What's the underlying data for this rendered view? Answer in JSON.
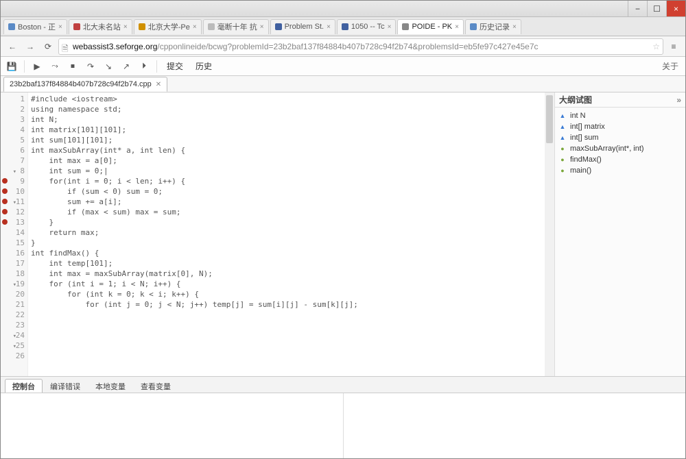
{
  "window_controls": {
    "min": "−",
    "max": "☐",
    "close": "×"
  },
  "browser_tabs": [
    {
      "label": "Boston - 正",
      "favicon": "#5a8ac6",
      "active": false
    },
    {
      "label": "北大未名站",
      "favicon": "#c04040",
      "active": false
    },
    {
      "label": "北京大学-Pe",
      "favicon": "#d09000",
      "active": false
    },
    {
      "label": "毫断十年 抗",
      "favicon": "#bbbbbb",
      "active": false
    },
    {
      "label": "Problem St.",
      "favicon": "#4060a0",
      "active": false
    },
    {
      "label": "1050 -- Tc",
      "favicon": "#4060a0",
      "active": false
    },
    {
      "label": "POIDE - PK",
      "favicon": "#888888",
      "active": true
    },
    {
      "label": "历史记录",
      "favicon": "#5a8ac6",
      "active": false
    }
  ],
  "address_bar": {
    "host": "webassist3.seforge.org",
    "path": "/cpponlineide/bcwg?problemId=23b2baf137f84884b407b728c94f2b74&problemsId=eb5fe97c427e45e7c"
  },
  "toolbar": {
    "submit": "提交",
    "history": "历史",
    "about": "关于"
  },
  "file_tab": {
    "name": "23b2baf137f84884b407b728c94f2b74.cpp"
  },
  "code_lines": [
    {
      "n": 1,
      "text": "#include <iostream>"
    },
    {
      "n": 2,
      "text": "using namespace std;"
    },
    {
      "n": 3,
      "text": ""
    },
    {
      "n": 4,
      "text": "int N;"
    },
    {
      "n": 5,
      "text": "int matrix[101][101];"
    },
    {
      "n": 6,
      "text": "int sum[101][101];"
    },
    {
      "n": 7,
      "text": ""
    },
    {
      "n": 8,
      "text": "int maxSubArray(int* a, int len) {",
      "fold": true
    },
    {
      "n": 9,
      "text": "    int max = a[0];",
      "bp": true
    },
    {
      "n": 10,
      "text": "    int sum = 0;|",
      "bp": true
    },
    {
      "n": 11,
      "text": "    for(int i = 0; i < len; i++) {",
      "bp": true,
      "fold": true
    },
    {
      "n": 12,
      "text": "        if (sum < 0) sum = 0;",
      "bp": true
    },
    {
      "n": 13,
      "text": "        sum += a[i];",
      "bp": true
    },
    {
      "n": 14,
      "text": "        if (max < sum) max = sum;"
    },
    {
      "n": 15,
      "text": "    }"
    },
    {
      "n": 16,
      "text": "    return max;"
    },
    {
      "n": 17,
      "text": "}"
    },
    {
      "n": 18,
      "text": ""
    },
    {
      "n": 19,
      "text": "int findMax() {",
      "fold": true
    },
    {
      "n": 20,
      "text": "    int temp[101];"
    },
    {
      "n": 21,
      "text": ""
    },
    {
      "n": 22,
      "text": "    int max = maxSubArray(matrix[0], N);"
    },
    {
      "n": 23,
      "text": ""
    },
    {
      "n": 24,
      "text": "    for (int i = 1; i < N; i++) {",
      "fold": true
    },
    {
      "n": 25,
      "text": "        for (int k = 0; k < i; k++) {",
      "fold": true
    },
    {
      "n": 26,
      "text": "            for (int j = 0; j < N; j++) temp[j] = sum[i][j] - sum[k][j];"
    }
  ],
  "outline": {
    "title": "大纲试图",
    "items": [
      {
        "kind": "var",
        "label": "int N"
      },
      {
        "kind": "var",
        "label": "int[] matrix"
      },
      {
        "kind": "var",
        "label": "int[] sum"
      },
      {
        "kind": "fn",
        "label": "maxSubArray(int*, int)"
      },
      {
        "kind": "fn",
        "label": "findMax()"
      },
      {
        "kind": "fn",
        "label": "main()"
      }
    ]
  },
  "bottom_tabs": [
    {
      "label": "控制台",
      "active": true
    },
    {
      "label": "编译错误",
      "active": false
    },
    {
      "label": "本地变量",
      "active": false
    },
    {
      "label": "查看变量",
      "active": false
    }
  ]
}
